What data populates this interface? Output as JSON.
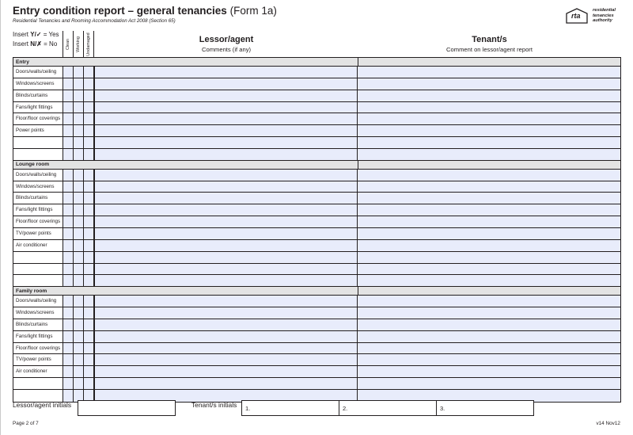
{
  "header": {
    "title": "Entry condition report – general tenancies",
    "form_id": "(Form 1a)",
    "subtitle": "Residential Tenancies and Rooming Accommodation Act 2008 (Section 65)"
  },
  "logo": {
    "mark": "rta",
    "words": [
      "residential",
      "tenancies",
      "authority"
    ]
  },
  "legend": {
    "yes_prefix": "Insert ",
    "yes_keys": "Y/✓",
    "yes_suffix": " = Yes",
    "no_prefix": "Insert ",
    "no_keys": "N/✗",
    "no_suffix": " = No"
  },
  "check_columns": [
    "Clean",
    "Working",
    "Undamaged"
  ],
  "columns": {
    "lessor_title": "Lessor/agent",
    "lessor_sub": "Comments (if any)",
    "tenant_title": "Tenant/s",
    "tenant_sub": "Comment on lessor/agent report"
  },
  "sections": [
    {
      "title": "Entry",
      "rows": [
        "Doors/walls/ceiling",
        "Windows/screens",
        "Blinds/curtains",
        "Fans/light fittings",
        "Floor/floor coverings",
        "Power points",
        "",
        ""
      ]
    },
    {
      "title": "Lounge room",
      "rows": [
        "Doors/walls/ceiling",
        "Windows/screens",
        "Blinds/curtains",
        "Fans/light fittings",
        "Floor/floor coverings",
        "TV/power points",
        "Air conditioner",
        "",
        "",
        ""
      ]
    },
    {
      "title": "Family room",
      "rows": [
        "Doors/walls/ceiling",
        "Windows/screens",
        "Blinds/curtains",
        "Fans/light fittings",
        "Floor/floor coverings",
        "TV/power points",
        "Air conditioner",
        "",
        ""
      ]
    }
  ],
  "initials": {
    "lessor_label": "Lessor/agent initials",
    "tenant_label": "Tenant/s initials",
    "tenant_boxes": [
      "1.",
      "2.",
      "3."
    ]
  },
  "footer": {
    "page": "Page 2 of 7",
    "version": "v14 Nov12"
  }
}
